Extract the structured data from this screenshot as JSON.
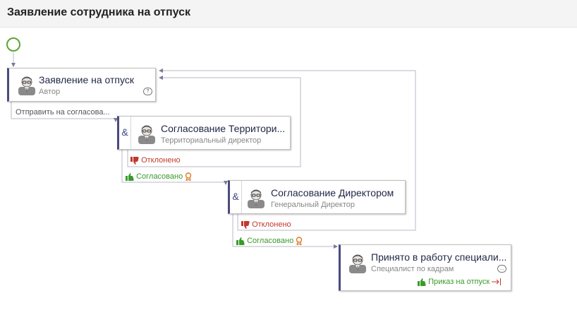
{
  "page": {
    "title": "Заявление сотрудника на отпуск"
  },
  "nodes": [
    {
      "title": "Заявление на отпуск",
      "subtitle": "Автор"
    },
    {
      "title": "Согласование Территори...",
      "subtitle": "Территориальный директор"
    },
    {
      "title": "Согласование Директором",
      "subtitle": "Генеральный Директор"
    },
    {
      "title": "Принято в работу специали...",
      "subtitle": "Специалист по кадрам"
    }
  ],
  "edges": {
    "send": "Отправить на согласова...",
    "rejected_1": "Отклонено",
    "approved_1": "Согласовано",
    "rejected_2": "Отклонено",
    "approved_2": "Согласовано",
    "order": "Приказ на отпуск"
  },
  "parallel_symbol": "&",
  "colors": {
    "node_border": "#4b4b7e",
    "approved": "#3a9a2a",
    "rejected": "#c0392b",
    "start": "#5aa532",
    "award": "#e07b2a"
  },
  "icons": [
    "user-avatar-icon",
    "comment-icon",
    "thumbs-up-icon",
    "thumbs-down-icon",
    "award-icon",
    "exit-arrow-icon"
  ]
}
